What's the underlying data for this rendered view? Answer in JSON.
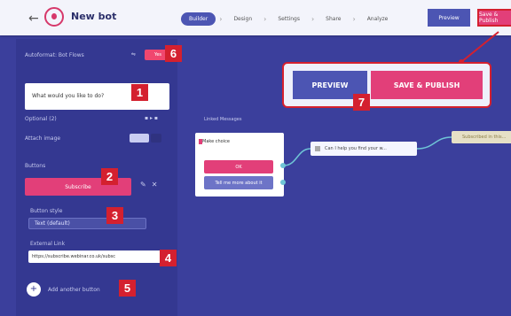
{
  "header": {
    "back_icon": "arrow-left-icon",
    "title": "New bot",
    "steps": [
      "Builder",
      "Design",
      "Settings",
      "Share",
      "Analyze"
    ],
    "active_step": "Builder",
    "preview_label": "Preview",
    "save_label": "Save & Publish"
  },
  "sidebar": {
    "top_row_label": "Autoformat: Bot Flows",
    "toggle_label": "Yes",
    "question_text": "What would you like to do?",
    "answer_label": "Optional (2)",
    "media_label": "Attach image",
    "section_label": "Buttons",
    "button_label": "Subscribe",
    "button_style_label": "Button style",
    "button_style_value": "Text (default)",
    "external_link_label": "External Link",
    "external_link_value": "https://subscribe.webinar.co.uk/subsc",
    "add_button_label": "Add another button"
  },
  "canvas": {
    "group_label": "Linked Messages",
    "choice_node_header": "Make choice",
    "choice_a": "OK",
    "choice_b": "Tell me more about it",
    "question_node": "Can I help you find your w...",
    "far_node": "Subscribed in this..."
  },
  "callout": {
    "preview": "PREVIEW",
    "save_publish": "SAVE & PUBLISH"
  },
  "badges": [
    "1",
    "2",
    "3",
    "4",
    "5",
    "6",
    "7"
  ],
  "colors": {
    "canvas": "#3b3f9c",
    "sidebar": "#343891",
    "accent_pink": "#e23f79",
    "accent_blue": "#4c55b3",
    "badge_red": "#d4202f"
  }
}
